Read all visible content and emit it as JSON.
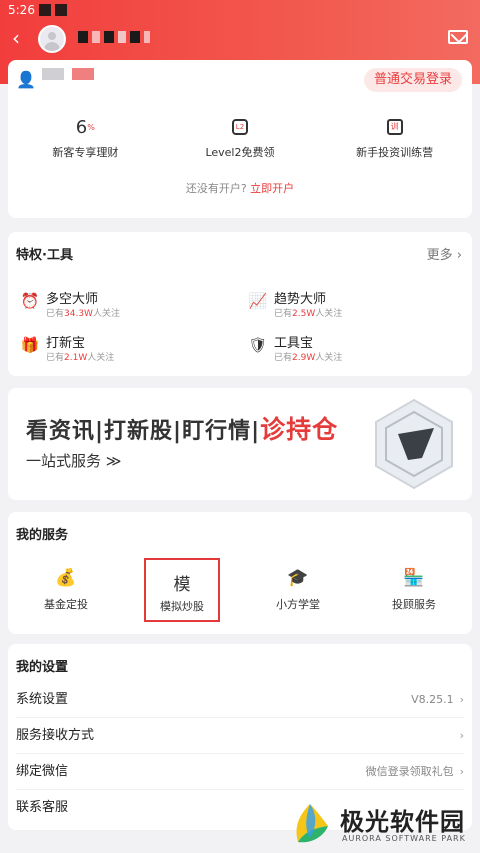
{
  "status_bar": {
    "time": "5:26"
  },
  "header": {
    "back_icon": "back-chevron-icon",
    "mail_icon": "mail-icon"
  },
  "account_card": {
    "login_button": "普通交易登录",
    "features": [
      {
        "icon": "new-user-finance-icon",
        "icon_text": "6",
        "label": "新客专享理财"
      },
      {
        "icon": "level2-icon",
        "icon_text": "L2",
        "label": "Level2免费领"
      },
      {
        "icon": "training-camp-icon",
        "icon_text": "训",
        "label": "新手投资训练营"
      }
    ],
    "open_prompt": "还没有开户?",
    "open_link": "立即开户"
  },
  "tools_card": {
    "title": "特权·工具",
    "more": "更多 ›",
    "tools": [
      {
        "name": "多空大师",
        "sub_prefix": "已有",
        "count": "34.3W",
        "sub_suffix": "人关注",
        "icon": "alarm-clock-icon",
        "glyph": "⏰"
      },
      {
        "name": "趋势大师",
        "sub_prefix": "已有",
        "count": "2.5W",
        "sub_suffix": "人关注",
        "icon": "trend-chart-icon",
        "glyph": "📈"
      },
      {
        "name": "打新宝",
        "sub_prefix": "已有",
        "count": "2.1W",
        "sub_suffix": "人关注",
        "icon": "new-stock-icon",
        "glyph": "🎁"
      },
      {
        "name": "工具宝",
        "sub_prefix": "已有",
        "count": "2.9W",
        "sub_suffix": "人关注",
        "icon": "toolbox-icon",
        "glyph": "🛡"
      }
    ]
  },
  "banner": {
    "main_text": "看资讯|打新股|盯行情|",
    "highlight": "诊持仓",
    "sub_text": "一站式服务 ≫"
  },
  "services_card": {
    "title": "我的服务",
    "items": [
      {
        "label": "基金定投",
        "icon": "money-bag-icon",
        "glyph": "💰"
      },
      {
        "label": "模拟炒股",
        "icon": "simulate-icon",
        "glyph": "模"
      },
      {
        "label": "小方学堂",
        "icon": "graduation-cap-icon",
        "glyph": "🎓"
      },
      {
        "label": "投顾服务",
        "icon": "advisor-store-icon",
        "glyph": "🏪"
      }
    ]
  },
  "settings_card": {
    "title": "我的设置",
    "rows": [
      {
        "label": "系统设置",
        "right": "V8.25.1",
        "chevron": "›"
      },
      {
        "label": "服务接收方式",
        "right": "",
        "chevron": "›"
      },
      {
        "label": "绑定微信",
        "right": "微信登录领取礼包",
        "chevron": "›"
      },
      {
        "label": "联系客服",
        "right": "",
        "chevron": ""
      }
    ]
  },
  "watermark": {
    "title": "极光软件园",
    "subtitle": "AURORA SOFTWARE PARK"
  },
  "colors": {
    "header": "#f23d3d",
    "accent": "#ea3d3d"
  }
}
